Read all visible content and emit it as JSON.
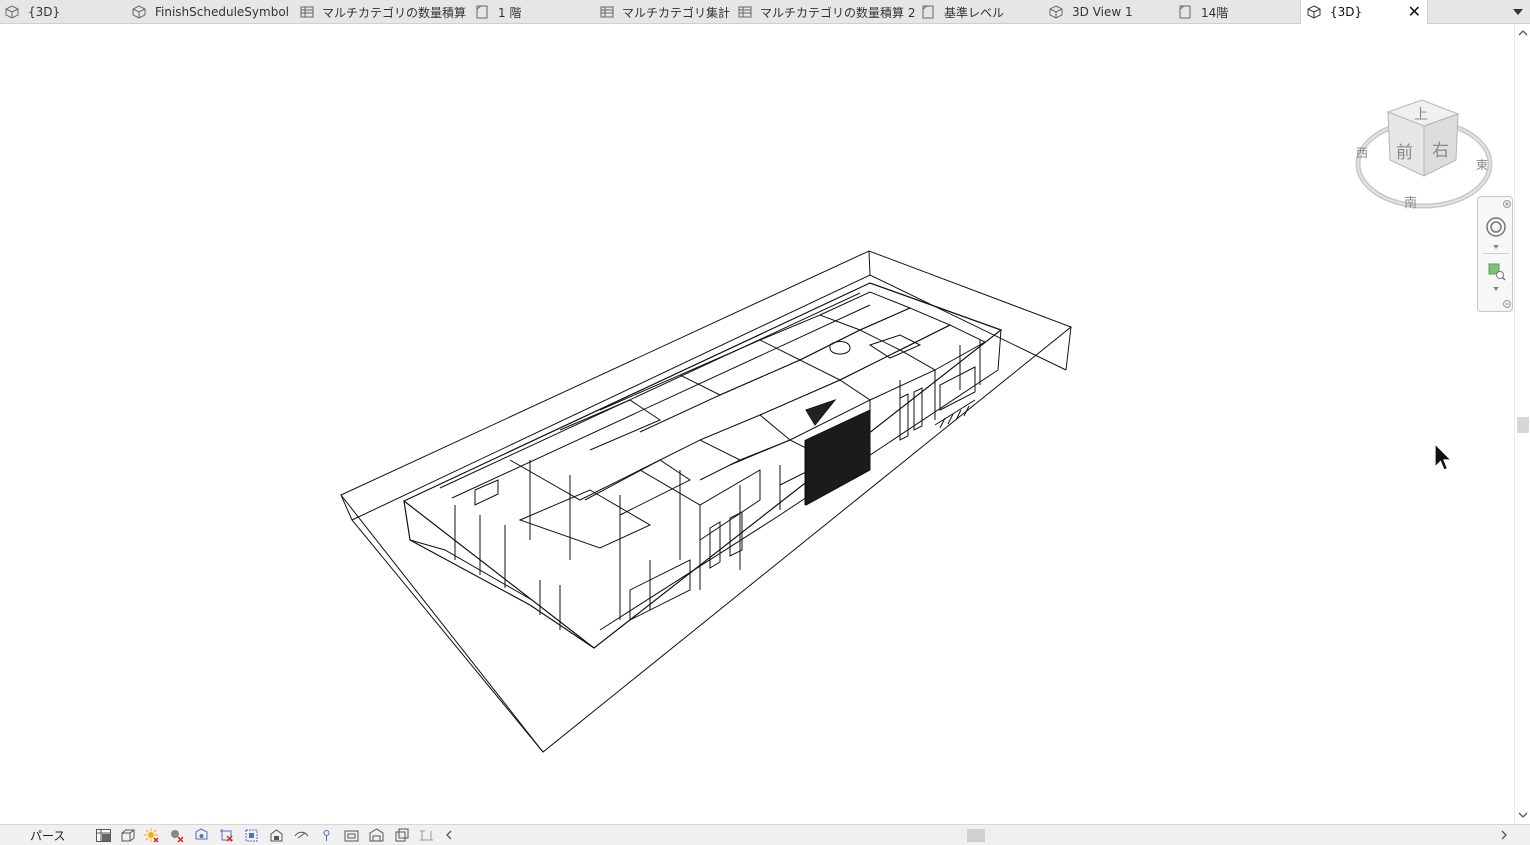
{
  "tabs": [
    {
      "label": "{3D}",
      "icon": "3d-view-icon"
    },
    {
      "label": "FinishScheduleSymbol",
      "icon": "3d-view-icon"
    },
    {
      "label": "マルチカテゴリの数量積算",
      "icon": "schedule-icon"
    },
    {
      "label": "1 階",
      "icon": "floor-plan-icon"
    },
    {
      "label": "マルチカテゴリ集計",
      "icon": "schedule-icon"
    },
    {
      "label": "マルチカテゴリの数量積算 2",
      "icon": "schedule-icon"
    },
    {
      "label": "基準レベル",
      "icon": "floor-plan-icon"
    },
    {
      "label": "3D View 1",
      "icon": "3d-view-icon"
    },
    {
      "label": "14階",
      "icon": "floor-plan-icon"
    },
    {
      "label": "{3D}",
      "icon": "3d-view-icon",
      "active": true
    }
  ],
  "viewcube": {
    "top": "上",
    "front": "前",
    "right": "右",
    "compass_west": "西",
    "compass_east": "東",
    "compass_south": "南"
  },
  "statusbar": {
    "view_mode": "パース"
  },
  "colors": {
    "tabbar_bg": "#e6e6e6",
    "active_tab_bg": "#ffffff",
    "model_line": "#111111",
    "viewcube_face": "#e8e8e8"
  }
}
